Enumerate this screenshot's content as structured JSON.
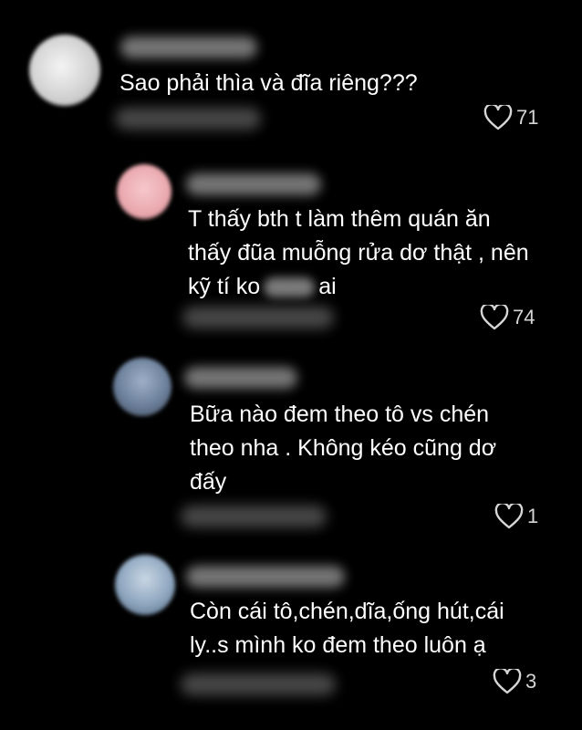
{
  "comments": [
    {
      "text_lines": [
        "Sao phải thìa và đĩa riêng???"
      ],
      "likes": "71",
      "icon": "heart-icon"
    },
    {
      "text_lines": [
        "T thấy bth t làm thêm quán ăn",
        "thấy đũa muỗng rửa dơ thật , nên",
        "kỹ tí ko",
        "ai"
      ],
      "likes": "74",
      "icon": "heart-icon"
    },
    {
      "text_lines": [
        "Bữa nào đem theo tô vs chén",
        "theo nha . Không kéo cũng dơ",
        "đấy"
      ],
      "likes": "1",
      "icon": "heart-icon"
    },
    {
      "text_lines": [
        "Còn cái tô,chén,dĩa,ống hút,cái",
        "ly..s mình ko đem theo luôn ạ"
      ],
      "likes": "3",
      "icon": "heart-icon"
    }
  ]
}
